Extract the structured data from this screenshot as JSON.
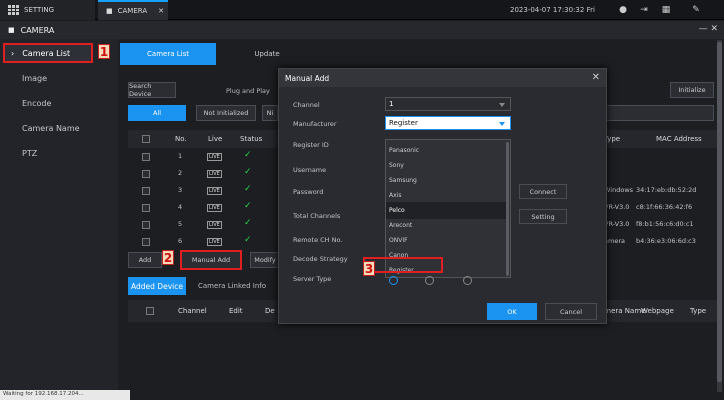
{
  "topbar": {
    "setting_tab": "SETTING",
    "camera_tab": "CAMERA",
    "clock": "2023-04-07 17:30:32 Fri"
  },
  "header": {
    "title": "CAMERA"
  },
  "sidebar": {
    "items": [
      {
        "label": "Camera List"
      },
      {
        "label": "Image"
      },
      {
        "label": "Encode"
      },
      {
        "label": "Camera Name"
      },
      {
        "label": "PTZ"
      }
    ]
  },
  "annotations": {
    "one": "1",
    "two": "2",
    "three": "3"
  },
  "main": {
    "tabs": [
      {
        "label": "Camera List"
      },
      {
        "label": "Update"
      }
    ],
    "search_device": "Search Device",
    "plug_and_play": "Plug and Play",
    "initialize": "Initialize",
    "filters": [
      {
        "label": "All"
      },
      {
        "label": "Not Initialized"
      },
      {
        "label": "Ni"
      }
    ],
    "columns": {
      "no": "No.",
      "live": "Live",
      "status": "Status",
      "type": "Type",
      "mac": "MAC Address"
    },
    "rows": [
      {
        "no": "1",
        "live": "LIVE",
        "type": "",
        "mac": ""
      },
      {
        "no": "2",
        "live": "LIVE",
        "type": "",
        "mac": ""
      },
      {
        "no": "3",
        "live": "LIVE",
        "type": "Windows",
        "mac": "34:17:eb:db:52:2d"
      },
      {
        "no": "4",
        "live": "LIVE",
        "type": "VR-V3.0",
        "mac": "c8:1f:66:36:42:f6"
      },
      {
        "no": "5",
        "live": "LIVE",
        "type": "VR-V3.0",
        "mac": "f8:b1:56:c6:d0:c1"
      },
      {
        "no": "6",
        "live": "LIVE",
        "type": "amera",
        "mac": "b4:36:e3:06:6d:c3"
      }
    ],
    "add": "Add",
    "manual_add": "Manual Add",
    "modify": "Modify",
    "added_device": "Added Device",
    "camera_linked_info": "Camera Linked Info",
    "columns2": {
      "channel": "Channel",
      "edit": "Edit",
      "de": "De",
      "camera_name": "amera Name",
      "webpage": "Webpage",
      "type": "Type"
    }
  },
  "modal": {
    "title": "Manual Add",
    "labels": {
      "channel": "Channel",
      "manufacturer": "Manufacturer",
      "register_id": "Register ID",
      "username": "Username",
      "password": "Password",
      "total_channels": "Total Channels",
      "remote_ch_no": "Remote CH No.",
      "decode_strategy": "Decode Strategy",
      "server_type": "Server Type"
    },
    "channel_value": "1",
    "manufacturer_value": "Register",
    "options": [
      "Panasonic",
      "Sony",
      "Samsung",
      "Axis",
      "Pelco",
      "Arecont",
      "ONVIF",
      "Canon",
      "Register"
    ],
    "connect": "Connect",
    "setting": "Setting",
    "ok": "OK",
    "cancel": "Cancel"
  },
  "status_bar": "Waiting for 192.168.17.204..."
}
